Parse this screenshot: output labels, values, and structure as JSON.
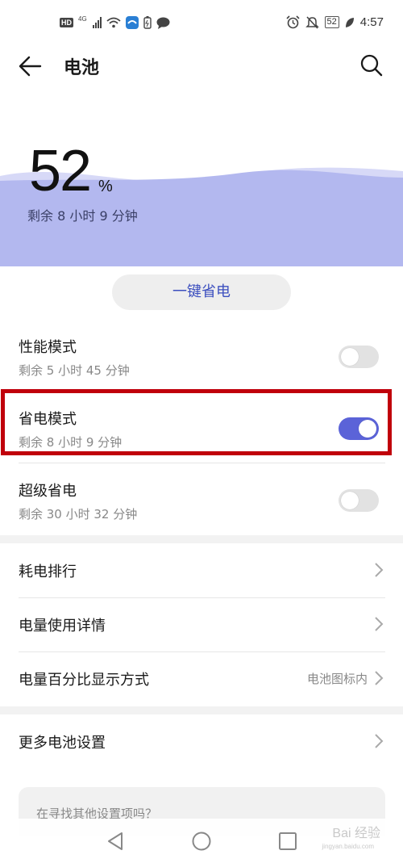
{
  "status_bar": {
    "hd_badge": "HD",
    "network": "4G",
    "battery_level": "52",
    "time": "4:57",
    "icons": [
      "hd-icon",
      "signal-icon",
      "wifi-icon",
      "app-notification-icon",
      "battery-saver-icon",
      "chat-bubble-icon",
      "alarm-icon",
      "mute-icon",
      "battery-icon",
      "leaf-icon"
    ]
  },
  "header": {
    "title": "电池",
    "back_icon": "arrow-left-icon",
    "search_icon": "search-icon"
  },
  "battery": {
    "percent": "52",
    "unit": "%",
    "remaining": "剩余 8 小时 9 分钟",
    "wave_color": "#b3b8ef"
  },
  "one_key": {
    "label": "一键省电"
  },
  "modes": [
    {
      "title": "性能模式",
      "subtitle": "剩余 5 小时 45 分钟",
      "enabled": false
    },
    {
      "title": "省电模式",
      "subtitle": "剩余 8 小时 9 分钟",
      "enabled": true
    },
    {
      "title": "超级省电",
      "subtitle": "剩余 30 小时 32 分钟",
      "enabled": false
    }
  ],
  "nav_items": [
    {
      "label": "耗电排行",
      "value": ""
    },
    {
      "label": "电量使用详情",
      "value": ""
    },
    {
      "label": "电量百分比显示方式",
      "value": "电池图标内"
    }
  ],
  "more": {
    "label": "更多电池设置"
  },
  "suggestion": {
    "text": "在寻找其他设置项吗？"
  },
  "watermark": {
    "text": "Bai 经验",
    "sub": "jingyan.baidu.com"
  },
  "colors": {
    "accent": "#5b63d8",
    "accent_text": "#3c4fbf",
    "highlight_border": "#c0000b"
  }
}
